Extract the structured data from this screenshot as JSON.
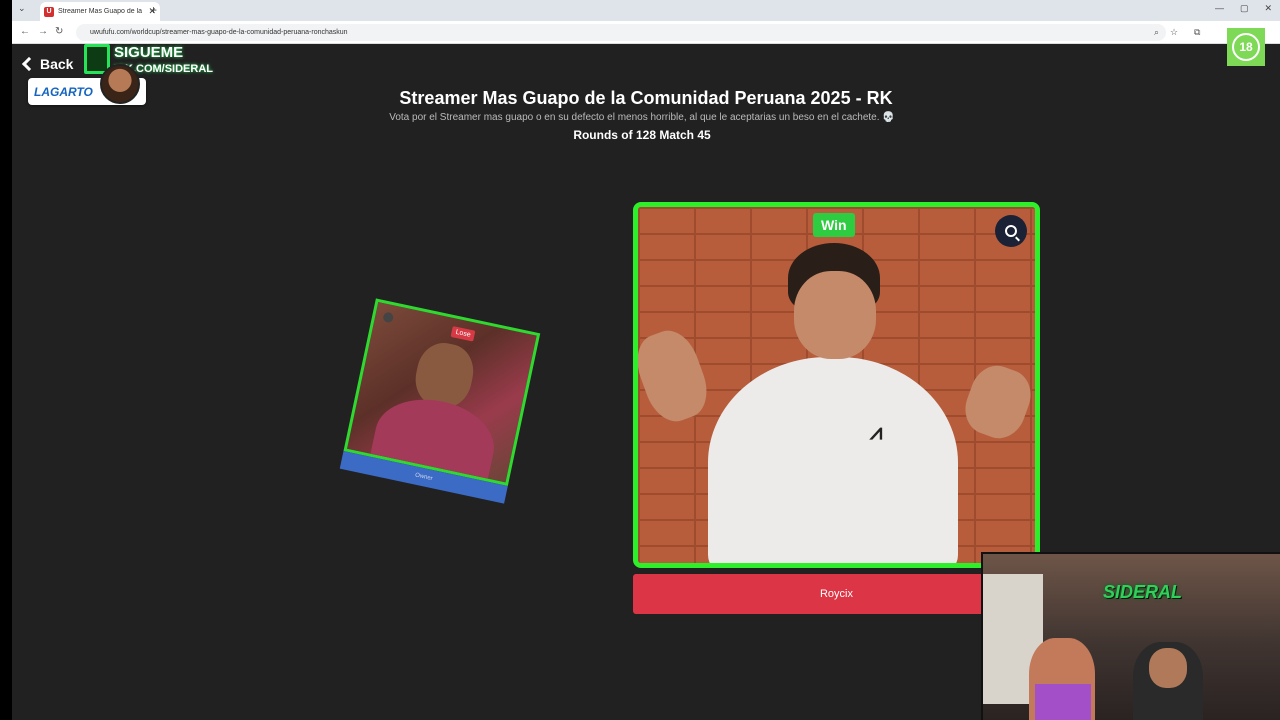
{
  "browser": {
    "tab_title": "Streamer Mas Guapo de la Comunidad Peruana 2025 - RK",
    "favicon_letter": "U",
    "url": "uwufufu.com/worldcup/streamer-mas-guapo-de-la-comunidad-peruana-ronchaskun"
  },
  "page": {
    "back_label": "Back",
    "title": "Streamer Mas Guapo de la Comunidad Peruana 2025 - RK",
    "subtitle": "Vota por el Streamer mas guapo o en su defecto el menos horrible, al que le aceptarias un beso en el cachete. 💀",
    "rounds": "Rounds of 128 Match 45",
    "age_badge": "18"
  },
  "overlay": {
    "sigueme_line1": "SIGUEME",
    "sigueme_line2": "ICK.COM/SIDERAL",
    "lagarto_label": "LAGARTO",
    "webcam_sign": "SIDERAL"
  },
  "matchup": {
    "loser": {
      "badge": "Lose",
      "name": "Owner"
    },
    "winner": {
      "badge": "Win",
      "name": "Roycix"
    }
  },
  "colors": {
    "win_border": "#2ef02a",
    "winner_button": "#dc3545",
    "loser_button": "#3b6bc4"
  }
}
